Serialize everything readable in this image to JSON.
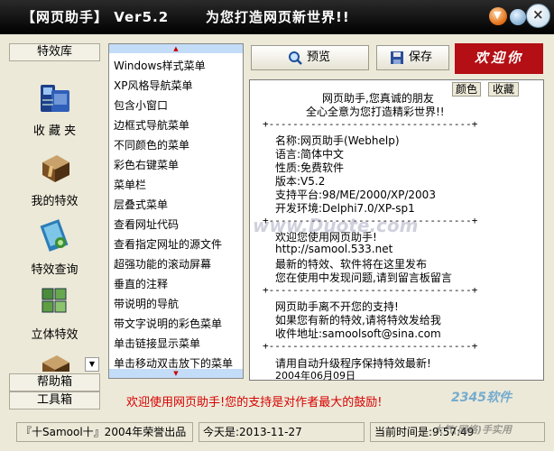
{
  "window": {
    "title_left": "【网页助手】 Ver5.2",
    "title_right": "为您打造网页新世界!!"
  },
  "sidebar": {
    "header_top": "特效库",
    "items": [
      {
        "label": "收 藏 夹",
        "icon": "folder-phone-icon"
      },
      {
        "label": "我的特效",
        "icon": "package-icon"
      },
      {
        "label": "特效查询",
        "icon": "book-search-icon"
      },
      {
        "label": "立体特效",
        "icon": "cubes-icon"
      },
      {
        "label": "",
        "icon": "package-icon"
      }
    ],
    "header_help": "帮助箱",
    "header_tools": "工具箱"
  },
  "menu_list": {
    "items": [
      "Windows样式菜单",
      "XP风格导航菜单",
      "包含小窗口",
      "边框式导航菜单",
      "不同颜色的菜单",
      "彩色右键菜单",
      "菜单栏",
      "层叠式菜单",
      "查看网址代码",
      "查看指定网址的源文件",
      "超强功能的滚动屏幕",
      "垂直的注释",
      "带说明的导航",
      "带文字说明的彩色菜单",
      "单击链接显示菜单",
      "单击移动双击放下的菜单"
    ]
  },
  "toolbar": {
    "preview_label": "预览",
    "save_label": "保存",
    "logo_text": "欢迎你"
  },
  "content": {
    "color_button": "颜色",
    "fav_button": "收藏",
    "lines": [
      "网页助手,您真诚的朋友",
      "全心全意为您打造精彩世界!!",
      "+----------------------------------+",
      "名称:网页助手(Webhelp)",
      "语言:简体中文",
      "性质:免费软件",
      "版本:V5.2",
      "支持平台:98/ME/2000/XP/2003",
      "开发环境:Delphi7.0/XP-sp1",
      "+----------------------------------+",
      "欢迎您使用网页助手!",
      "http://samool.533.net",
      "最新的特效、软件将在这里发布",
      "您在使用中发现问题,请到留言板留言",
      "+----------------------------------+",
      "网页助手离不开您的支持!",
      "如果您有新的特效,请将特效发给我",
      "收件地址:samoolsoft@sina.com",
      "+----------------------------------+",
      "请用自动升级程序保持特效最新!",
      "2004年06月09日"
    ]
  },
  "message": "欢迎使用网页助手!您的支持是对作者最大的鼓励!",
  "status": {
    "copyright": "『十Samool十』2004年荣誉出品",
    "today": "今天是:2013-11-27",
    "time": "当前时间是:9:57:49"
  },
  "watermarks": [
    "www.Duote.com",
    "2345软件",
    "大气(网络)手实用"
  ],
  "colors": {
    "titlebar": "#000000",
    "frame": "#ece9d8",
    "message": "#d80000",
    "logo_bg": "#b40f14",
    "list_bar": "#c3dcf7"
  }
}
